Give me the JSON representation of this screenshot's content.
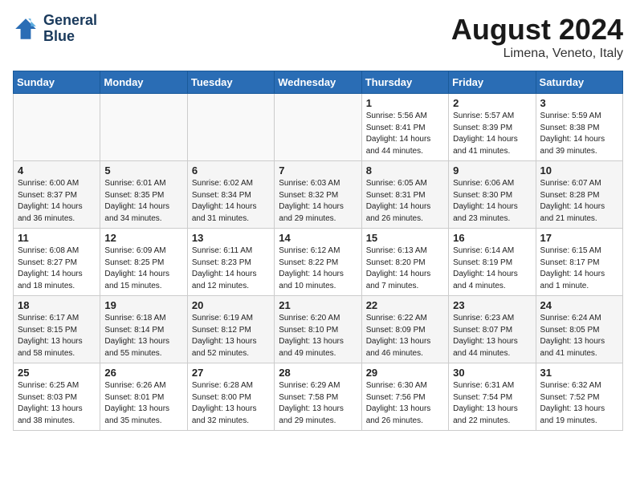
{
  "header": {
    "logo_line1": "General",
    "logo_line2": "Blue",
    "month_year": "August 2024",
    "location": "Limena, Veneto, Italy"
  },
  "weekdays": [
    "Sunday",
    "Monday",
    "Tuesday",
    "Wednesday",
    "Thursday",
    "Friday",
    "Saturday"
  ],
  "weeks": [
    [
      {
        "day": "",
        "info": ""
      },
      {
        "day": "",
        "info": ""
      },
      {
        "day": "",
        "info": ""
      },
      {
        "day": "",
        "info": ""
      },
      {
        "day": "1",
        "info": "Sunrise: 5:56 AM\nSunset: 8:41 PM\nDaylight: 14 hours\nand 44 minutes."
      },
      {
        "day": "2",
        "info": "Sunrise: 5:57 AM\nSunset: 8:39 PM\nDaylight: 14 hours\nand 41 minutes."
      },
      {
        "day": "3",
        "info": "Sunrise: 5:59 AM\nSunset: 8:38 PM\nDaylight: 14 hours\nand 39 minutes."
      }
    ],
    [
      {
        "day": "4",
        "info": "Sunrise: 6:00 AM\nSunset: 8:37 PM\nDaylight: 14 hours\nand 36 minutes."
      },
      {
        "day": "5",
        "info": "Sunrise: 6:01 AM\nSunset: 8:35 PM\nDaylight: 14 hours\nand 34 minutes."
      },
      {
        "day": "6",
        "info": "Sunrise: 6:02 AM\nSunset: 8:34 PM\nDaylight: 14 hours\nand 31 minutes."
      },
      {
        "day": "7",
        "info": "Sunrise: 6:03 AM\nSunset: 8:32 PM\nDaylight: 14 hours\nand 29 minutes."
      },
      {
        "day": "8",
        "info": "Sunrise: 6:05 AM\nSunset: 8:31 PM\nDaylight: 14 hours\nand 26 minutes."
      },
      {
        "day": "9",
        "info": "Sunrise: 6:06 AM\nSunset: 8:30 PM\nDaylight: 14 hours\nand 23 minutes."
      },
      {
        "day": "10",
        "info": "Sunrise: 6:07 AM\nSunset: 8:28 PM\nDaylight: 14 hours\nand 21 minutes."
      }
    ],
    [
      {
        "day": "11",
        "info": "Sunrise: 6:08 AM\nSunset: 8:27 PM\nDaylight: 14 hours\nand 18 minutes."
      },
      {
        "day": "12",
        "info": "Sunrise: 6:09 AM\nSunset: 8:25 PM\nDaylight: 14 hours\nand 15 minutes."
      },
      {
        "day": "13",
        "info": "Sunrise: 6:11 AM\nSunset: 8:23 PM\nDaylight: 14 hours\nand 12 minutes."
      },
      {
        "day": "14",
        "info": "Sunrise: 6:12 AM\nSunset: 8:22 PM\nDaylight: 14 hours\nand 10 minutes."
      },
      {
        "day": "15",
        "info": "Sunrise: 6:13 AM\nSunset: 8:20 PM\nDaylight: 14 hours\nand 7 minutes."
      },
      {
        "day": "16",
        "info": "Sunrise: 6:14 AM\nSunset: 8:19 PM\nDaylight: 14 hours\nand 4 minutes."
      },
      {
        "day": "17",
        "info": "Sunrise: 6:15 AM\nSunset: 8:17 PM\nDaylight: 14 hours\nand 1 minute."
      }
    ],
    [
      {
        "day": "18",
        "info": "Sunrise: 6:17 AM\nSunset: 8:15 PM\nDaylight: 13 hours\nand 58 minutes."
      },
      {
        "day": "19",
        "info": "Sunrise: 6:18 AM\nSunset: 8:14 PM\nDaylight: 13 hours\nand 55 minutes."
      },
      {
        "day": "20",
        "info": "Sunrise: 6:19 AM\nSunset: 8:12 PM\nDaylight: 13 hours\nand 52 minutes."
      },
      {
        "day": "21",
        "info": "Sunrise: 6:20 AM\nSunset: 8:10 PM\nDaylight: 13 hours\nand 49 minutes."
      },
      {
        "day": "22",
        "info": "Sunrise: 6:22 AM\nSunset: 8:09 PM\nDaylight: 13 hours\nand 46 minutes."
      },
      {
        "day": "23",
        "info": "Sunrise: 6:23 AM\nSunset: 8:07 PM\nDaylight: 13 hours\nand 44 minutes."
      },
      {
        "day": "24",
        "info": "Sunrise: 6:24 AM\nSunset: 8:05 PM\nDaylight: 13 hours\nand 41 minutes."
      }
    ],
    [
      {
        "day": "25",
        "info": "Sunrise: 6:25 AM\nSunset: 8:03 PM\nDaylight: 13 hours\nand 38 minutes."
      },
      {
        "day": "26",
        "info": "Sunrise: 6:26 AM\nSunset: 8:01 PM\nDaylight: 13 hours\nand 35 minutes."
      },
      {
        "day": "27",
        "info": "Sunrise: 6:28 AM\nSunset: 8:00 PM\nDaylight: 13 hours\nand 32 minutes."
      },
      {
        "day": "28",
        "info": "Sunrise: 6:29 AM\nSunset: 7:58 PM\nDaylight: 13 hours\nand 29 minutes."
      },
      {
        "day": "29",
        "info": "Sunrise: 6:30 AM\nSunset: 7:56 PM\nDaylight: 13 hours\nand 26 minutes."
      },
      {
        "day": "30",
        "info": "Sunrise: 6:31 AM\nSunset: 7:54 PM\nDaylight: 13 hours\nand 22 minutes."
      },
      {
        "day": "31",
        "info": "Sunrise: 6:32 AM\nSunset: 7:52 PM\nDaylight: 13 hours\nand 19 minutes."
      }
    ]
  ]
}
